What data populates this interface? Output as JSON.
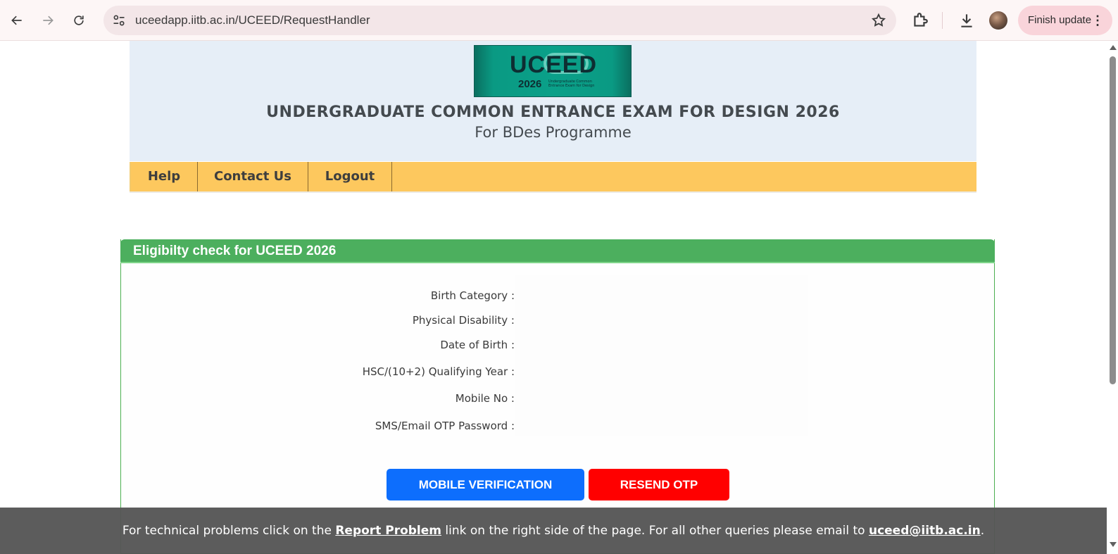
{
  "browser": {
    "url": "uceedapp.iitb.ac.in/UCEED/RequestHandler",
    "finish_update_label": "Finish update",
    "icons": [
      "back-icon",
      "forward-icon",
      "reload-icon",
      "site-info-icon",
      "bookmark-star-icon",
      "extensions-icon",
      "download-icon",
      "profile-avatar",
      "more-menu-icon"
    ]
  },
  "header": {
    "logo_text": "UCEED",
    "logo_year": "2026",
    "logo_tagline": "Undergraduate Common Entrance Exam for Design",
    "title": "UNDERGRADUATE COMMON ENTRANCE EXAM FOR DESIGN 2026",
    "subtitle": "For BDes Programme"
  },
  "menu": {
    "items": [
      {
        "label": "Help"
      },
      {
        "label": "Contact Us"
      },
      {
        "label": "Logout"
      }
    ]
  },
  "panel": {
    "title": "Eligibilty check for UCEED 2026",
    "fields": [
      {
        "label": "Birth Category :",
        "value": ""
      },
      {
        "label": "Physical Disability :",
        "value": ""
      },
      {
        "label": "Date of Birth :",
        "value": ""
      },
      {
        "label": "HSC/(10+2) Qualifying Year :",
        "value": ""
      },
      {
        "label": "Mobile No :",
        "value": ""
      },
      {
        "label": "SMS/Email OTP Password :",
        "value": ""
      }
    ],
    "buttons": {
      "mobile_verification": "MOBILE VERIFICATION",
      "resend_otp": "RESEND OTP"
    }
  },
  "footer": {
    "text_1": "For technical problems click on the ",
    "link_1": "Report Problem",
    "text_2": " link on the right side of the page. For all other queries please email to ",
    "link_2": "uceed@iitb.ac.in",
    "text_3": "."
  },
  "colors": {
    "menu_bar": "#fdc85e",
    "panel_header": "#4caf5e",
    "button_blue": "#0d6efd",
    "button_red": "#ff0000",
    "header_bg": "#e6eef7",
    "logo_teal": "#0aa089"
  }
}
